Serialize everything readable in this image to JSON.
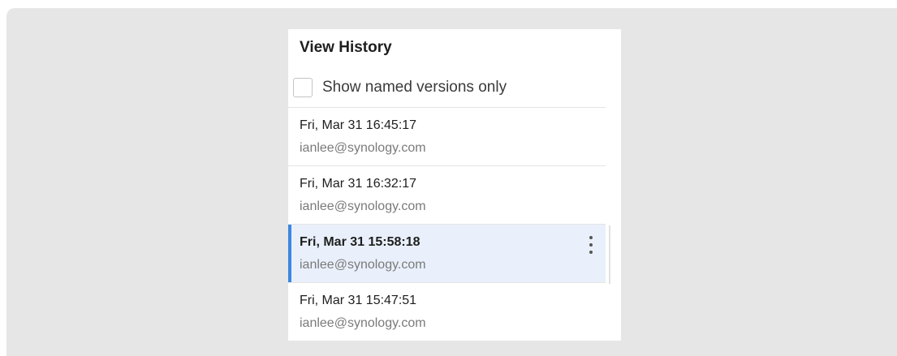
{
  "panel": {
    "title": "View History",
    "filter": {
      "label": "Show named versions only",
      "checked": false
    }
  },
  "versions": [
    {
      "date": "Fri, Mar 31 16:45:17",
      "user": "ianlee@synology.com",
      "selected": false
    },
    {
      "date": "Fri, Mar 31 16:32:17",
      "user": "ianlee@synology.com",
      "selected": false
    },
    {
      "date": "Fri, Mar 31 15:58:18",
      "user": "ianlee@synology.com",
      "selected": true
    },
    {
      "date": "Fri, Mar 31 15:47:51",
      "user": "ianlee@synology.com",
      "selected": false
    }
  ],
  "icons": {
    "more": "more-vertical-icon"
  },
  "colors": {
    "accent": "#3d86e0",
    "selected_bg": "#e9f0fb",
    "backdrop": "#e6e6e6"
  }
}
